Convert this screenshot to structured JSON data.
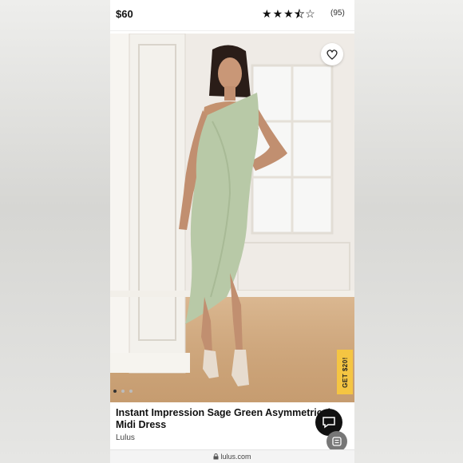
{
  "header": {
    "price": "$60",
    "rating": 3.5,
    "rating_max": 5,
    "review_count": "(95)"
  },
  "gallery": {
    "image_count": 3,
    "active_index": 0,
    "favorite_icon": "heart-icon"
  },
  "promo": {
    "label": "GET $20!",
    "color": "#f5c542"
  },
  "product": {
    "title": "Instant Impression Sage Green Asymmetrical Midi Dress",
    "brand": "Lulus"
  },
  "floating": {
    "chat_icon": "chat-icon",
    "reader_icon": "reader-icon"
  },
  "browser": {
    "url": "lulus.com",
    "lock_icon": "lock-icon"
  },
  "colors": {
    "dress": "#b8c9a7",
    "promo": "#f5c542",
    "chat_bg": "#111111"
  }
}
